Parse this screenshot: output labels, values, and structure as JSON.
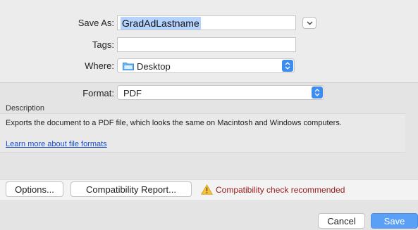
{
  "save_as": {
    "label": "Save As:",
    "value": "GradAdLastname"
  },
  "tags": {
    "label": "Tags:",
    "value": ""
  },
  "where": {
    "label": "Where:",
    "value": "Desktop"
  },
  "format": {
    "label": "Format:",
    "value": "PDF"
  },
  "description": {
    "title": "Description",
    "text": "Exports the document to a PDF file, which looks the same on Macintosh and Windows computers.",
    "link": "Learn more about file formats"
  },
  "actions": {
    "options": "Options...",
    "compatibility_report": "Compatibility Report...",
    "warning": "Compatibility check recommended"
  },
  "footer": {
    "cancel": "Cancel",
    "save": "Save"
  },
  "colors": {
    "accent": "#3d8cf1",
    "warning_text": "#9b1a1a",
    "link": "#1a4fd0"
  },
  "icons": {
    "where": "folder-icon",
    "warning": "warning-icon",
    "expand": "chevron-down-icon",
    "popup": "updown-arrows-icon"
  }
}
